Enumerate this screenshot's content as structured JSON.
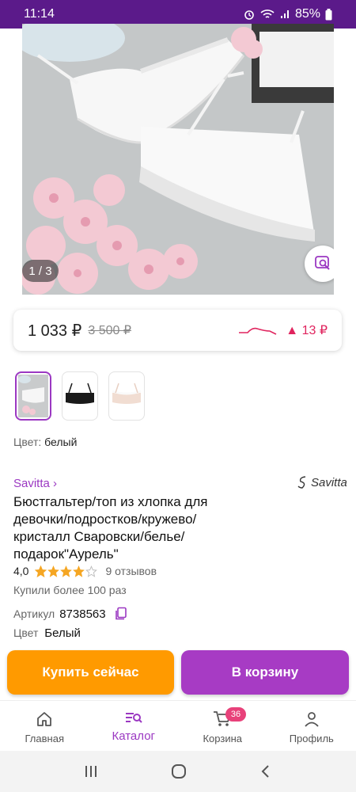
{
  "status_bar": {
    "time": "11:14",
    "battery": "85%"
  },
  "gallery": {
    "counter": "1 / 3"
  },
  "price": {
    "current": "1 033 ₽",
    "old": "3 500 ₽",
    "change": "▲ 13 ₽"
  },
  "colors": {
    "label": "Цвет:",
    "selected": "белый"
  },
  "product": {
    "brand": "Savitta ›",
    "brand_logo": "Savitta",
    "title": "Бюстгальтер/топ из хлопка для девочки/подростков/кружево/кристалл Сваровски/белье/подарок\"Аурель\"",
    "rating": "4,0",
    "reviews": "9 отзывов",
    "bought": "Купили более 100 раз",
    "article_label": "Артикул",
    "article": "8738563",
    "color_label": "Цвет",
    "color": "Белый"
  },
  "actions": {
    "buy_now": "Купить сейчас",
    "add_to_cart": "В корзину"
  },
  "nav": {
    "home": "Главная",
    "catalog": "Каталог",
    "cart": "Корзина",
    "cart_count": "36",
    "profile": "Профиль"
  },
  "theme": {
    "accent": "#9b38c2",
    "orange": "#ff9a00",
    "status_bar": "#5b1a8a"
  }
}
